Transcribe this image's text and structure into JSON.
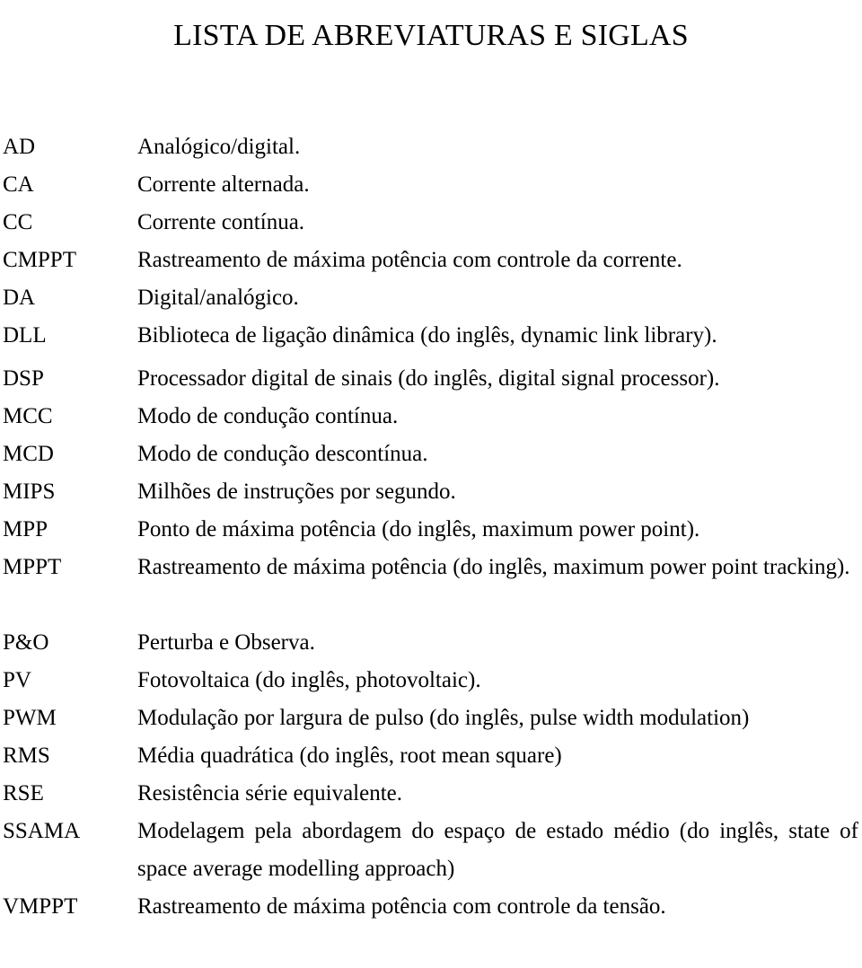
{
  "document": {
    "title": "LISTA DE ABREVIATURAS E SIGLAS"
  },
  "abbreviations": [
    {
      "term": "AD",
      "definition": "Analógico/digital."
    },
    {
      "term": "CA",
      "definition": "Corrente alternada."
    },
    {
      "term": "CC",
      "definition": "Corrente contínua."
    },
    {
      "term": "CMPPT",
      "definition": "Rastreamento de máxima potência com controle da corrente."
    },
    {
      "term": "DA",
      "definition": "Digital/analógico."
    },
    {
      "term": "DLL",
      "definition": "Biblioteca de ligação dinâmica (do inglês, dynamic link library)."
    },
    {
      "term": "DSP",
      "definition": "Processador digital de sinais (do inglês, digital signal processor)."
    },
    {
      "term": "MCC",
      "definition": "Modo de condução contínua."
    },
    {
      "term": "MCD",
      "definition": "Modo de condução descontínua."
    },
    {
      "term": "MIPS",
      "definition": "Milhões de instruções por segundo."
    },
    {
      "term": "MPP",
      "definition": "Ponto de máxima potência (do inglês, maximum power point)."
    },
    {
      "term": "MPPT",
      "definition": "Rastreamento de máxima potência (do inglês, maximum power point tracking)."
    },
    {
      "term": "P&O",
      "definition": "Perturba e Observa."
    },
    {
      "term": "PV",
      "definition": "Fotovoltaica (do inglês, photovoltaic)."
    },
    {
      "term": "PWM",
      "definition": "Modulação por largura de pulso (do inglês, pulse width modulation)"
    },
    {
      "term": "RMS",
      "definition": "Média quadrática (do inglês, root mean square)"
    },
    {
      "term": "RSE",
      "definition": "Resistência série equivalente."
    },
    {
      "term": "SSAMA",
      "definition": "Modelagem pela abordagem do espaço de estado médio (do inglês, state of space average modelling approach)"
    },
    {
      "term": "VMPPT",
      "definition": "Rastreamento de máxima potência com controle da tensão."
    }
  ]
}
